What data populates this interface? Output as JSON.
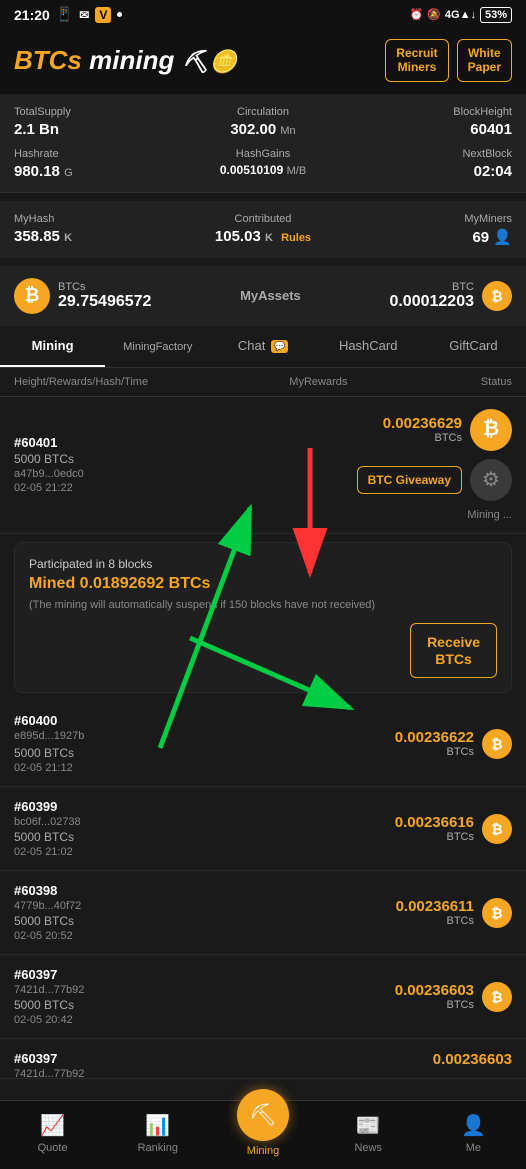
{
  "statusBar": {
    "time": "21:20",
    "icons": [
      "whatsapp",
      "message",
      "vpn",
      "dot"
    ],
    "rightIcons": [
      "alarm",
      "mute",
      "signal",
      "battery"
    ],
    "battery": "53"
  },
  "header": {
    "logo": "BTCs mining",
    "recruitMiners": "Recruit\nMiners",
    "whitePaper": "White\nPaper"
  },
  "stats": {
    "totalSupplyLabel": "TotalSupply",
    "totalSupplyValue": "2.1 Bn",
    "circulationLabel": "Circulation",
    "circulationValue": "302.00",
    "circulationUnit": "Mn",
    "blockHeightLabel": "BlockHeight",
    "blockHeightValue": "60401",
    "hashrateLabel": "Hashrate",
    "hashrateValue": "980.18",
    "hashrateUnit": "G",
    "hashGainsLabel": "HashGains",
    "hashGainsValue": "0.00510109",
    "hashGainsUnit": "M/B",
    "nextBlockLabel": "NextBlock",
    "nextBlockValue": "02:04"
  },
  "myStats": {
    "myHashLabel": "MyHash",
    "myHashValue": "358.85",
    "myHashUnit": "K",
    "contributedLabel": "Contributed",
    "contributedValue": "105.03",
    "contributedUnit": "K",
    "rulesLink": "Rules",
    "myMinersLabel": "MyMiners",
    "myMinersValue": "69",
    "myMinersIcon": "👤"
  },
  "assets": {
    "btcsLabel": "BTCs",
    "btcsValue": "29.75496572",
    "middleLabel": "MyAssets",
    "btcLabel": "BTC",
    "btcValue": "0.00012203"
  },
  "tabs": [
    {
      "id": "mining",
      "label": "Mining",
      "active": true,
      "badge": null
    },
    {
      "id": "miningFactory",
      "label": "MiningFactory",
      "active": false,
      "badge": null
    },
    {
      "id": "chat",
      "label": "Chat",
      "active": false,
      "badge": "💬"
    },
    {
      "id": "hashCard",
      "label": "HashCard",
      "active": false,
      "badge": null
    },
    {
      "id": "giftCard",
      "label": "GiftCard",
      "active": false,
      "badge": null
    }
  ],
  "tableHeaders": {
    "col1": "Height/Rewards/Hash/Time",
    "col2": "MyRewards",
    "col3": "Status"
  },
  "firstBlock": {
    "id": "#60401",
    "btcs": "5000 BTCs",
    "hash": "a47b9...0edc0",
    "time": "02-05 21:22",
    "amount": "0.00236629",
    "unit": "BTCs",
    "giveawayLabel": "BTC Giveaway",
    "statusLabel": "Mining ..."
  },
  "giveaway": {
    "participatedText": "Participated in 8 blocks",
    "minedText": "Mined 0.01892692 BTCs",
    "suspendText": "(The mining will automatically suspend if 150 blocks have not received)",
    "receiveBtnLabel": "Receive\nBTCs"
  },
  "blocks": [
    {
      "id": "#60400",
      "hash": "e895d...1927b",
      "btcs": "5000 BTCs",
      "time": "02-05 21:12",
      "amount": "0.00236622",
      "unit": "BTCs"
    },
    {
      "id": "#60399",
      "hash": "bc06f...02738",
      "btcs": "5000 BTCs",
      "time": "02-05 21:02",
      "amount": "0.00236616",
      "unit": "BTCs"
    },
    {
      "id": "#60398",
      "hash": "4779b...40f72",
      "btcs": "5000 BTCs",
      "time": "02-05 20:52",
      "amount": "0.00236611",
      "unit": "BTCs"
    },
    {
      "id": "#60397",
      "hash": "7421d...77b92",
      "btcs": "5000 BTCs",
      "time": "02-05 20:42",
      "amount": "0.00236603",
      "unit": "BTCs"
    }
  ],
  "bottomNav": [
    {
      "id": "quote",
      "label": "Quote",
      "icon": "📈",
      "active": false
    },
    {
      "id": "ranking",
      "label": "Ranking",
      "icon": "📊",
      "active": false
    },
    {
      "id": "mining",
      "label": "Mining",
      "icon": "⛏",
      "active": true,
      "center": true
    },
    {
      "id": "news",
      "label": "News",
      "icon": "📰",
      "active": false
    },
    {
      "id": "me",
      "label": "Me",
      "icon": "👤",
      "active": false
    }
  ]
}
